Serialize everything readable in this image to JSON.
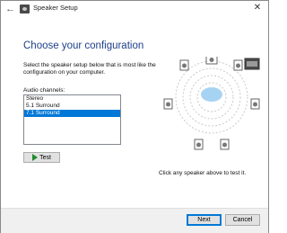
{
  "window": {
    "title": "Speaker Setup"
  },
  "heading": "Choose your configuration",
  "description": "Select the speaker setup below that is most like the configuration on your computer.",
  "channels": {
    "label": "Audio channels:",
    "options": [
      "Stereo",
      "5.1 Surround",
      "7.1 Surround"
    ],
    "selected": "7.1 Surround"
  },
  "test_button": {
    "label": "Test",
    "icon": "play-icon"
  },
  "hint": "Click any speaker above to test it.",
  "footer": {
    "next_label": "Next",
    "cancel_label": "Cancel"
  },
  "colors": {
    "heading": "#1e3f8a",
    "selection": "#0078d7",
    "play": "#1f8a2e"
  }
}
